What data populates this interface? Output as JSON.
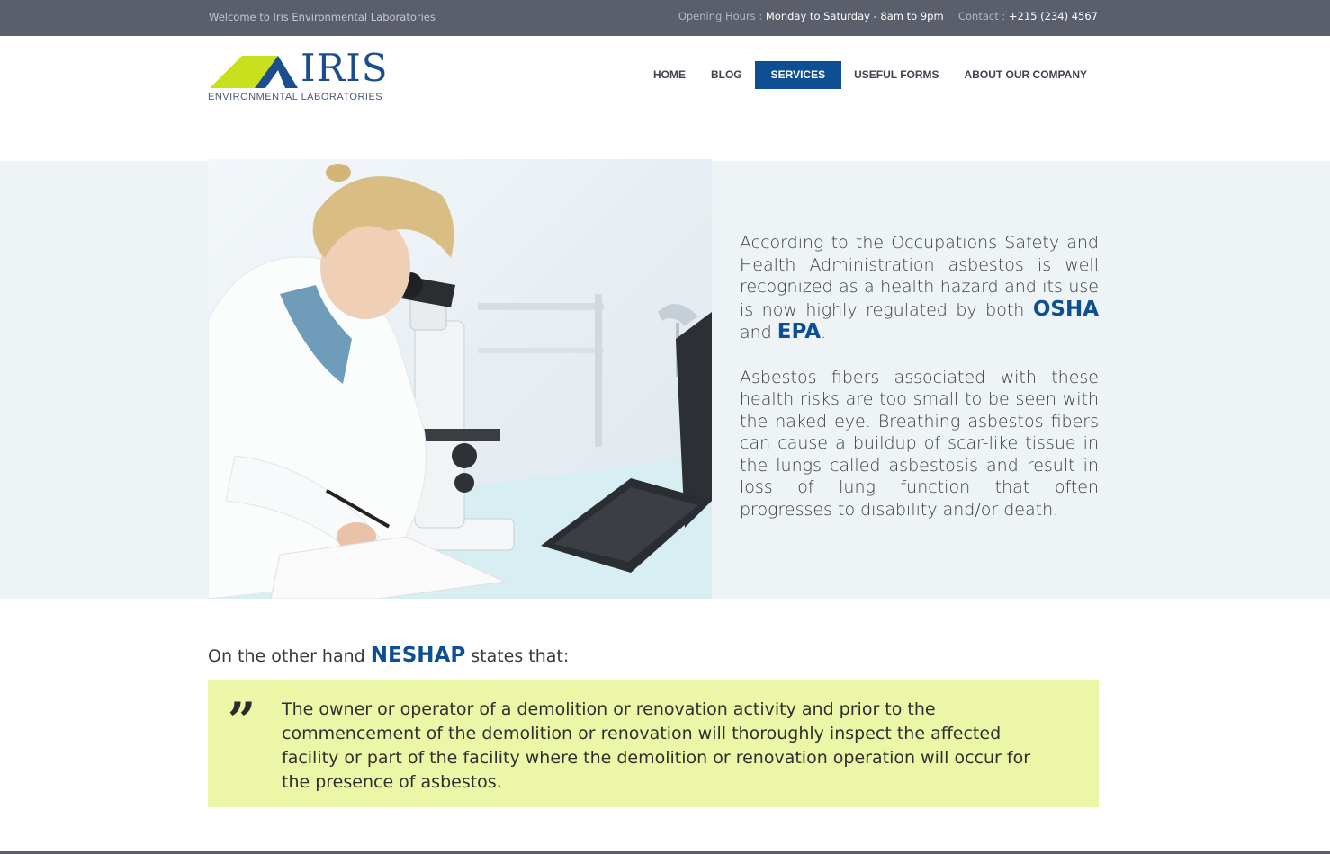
{
  "topbar": {
    "welcome": "Welcome to Iris Environmental Laboratories",
    "hours_label": "Opening Hours :",
    "hours_value": "Monday to Saturday - 8am to 9pm",
    "contact_label": "Contact :",
    "contact_value": "+215 (234) 4567"
  },
  "logo": {
    "name": "IRIS",
    "subtitle": "ENVIRONMENTAL  LABORATORIES",
    "colors": {
      "green": "#c8e01e",
      "blue": "#1c4e8f"
    }
  },
  "nav": {
    "items": [
      {
        "label": "HOME",
        "active": false
      },
      {
        "label": "BLOG",
        "active": false
      },
      {
        "label": "SERVICES",
        "active": true
      },
      {
        "label": "USEFUL FORMS",
        "active": false
      },
      {
        "label": "ABOUT OUR COMPANY",
        "active": false
      }
    ]
  },
  "hero": {
    "p1_before": "According to the Occupations Safety and Health Administration asbestos is well recognized as a health hazard and its use is now highly regulated by both ",
    "p1_em1": "OSHA",
    "p1_mid": " and ",
    "p1_em2": "EPA",
    "p1_end": ".",
    "p2": "Asbestos fibers associated with these health risks are too small to be seen with the naked eye. Breathing asbestos fibers can cause a buildup of scar-like tissue in the lungs called asbestosis and result in loss of lung function that often progresses to disability and/or death."
  },
  "neshap": {
    "before": "On the other hand ",
    "em": "NESHAP",
    "after": " states that:"
  },
  "quote": {
    "mark": "”",
    "text": "The owner or operator of a demolition or renovation activity and prior to the commencement of the demolition or renovation will thoroughly inspect the affected facility or part of the facility where the demolition or renovation operation will occur for the presence of asbestos."
  },
  "colors": {
    "topbar": "#5b5f6b",
    "accent": "#0e4f93",
    "band": "#eef3f6",
    "quote_bg": "#ebf6a7"
  }
}
